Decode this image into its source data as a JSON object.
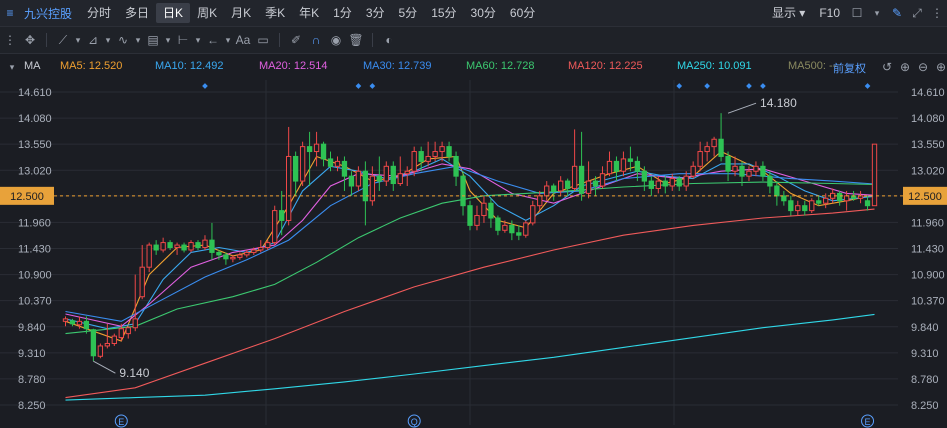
{
  "topbar": {
    "stock_name": "九兴控股",
    "periods": [
      "分时",
      "多日",
      "日K",
      "周K",
      "月K",
      "季K",
      "年K",
      "1分",
      "3分",
      "5分",
      "15分",
      "30分",
      "60分"
    ],
    "active_period": "日K",
    "display_label": "显示",
    "f10_label": "F10"
  },
  "toolbar": {
    "text_tool": "Aa"
  },
  "ma_bar": {
    "indicator": "MA",
    "items": [
      {
        "label": "MA5: 12.520",
        "color": "#f0a030"
      },
      {
        "label": "MA10: 12.492",
        "color": "#3aa8f0"
      },
      {
        "label": "MA20: 12.514",
        "color": "#e060e0"
      },
      {
        "label": "MA30: 12.739",
        "color": "#3a8df0"
      },
      {
        "label": "MA60: 12.728",
        "color": "#3cc870"
      },
      {
        "label": "MA120: 12.225",
        "color": "#f05a5a"
      },
      {
        "label": "MA250: 10.091",
        "color": "#30d8e8"
      },
      {
        "label": "MA500: --",
        "color": "#8a8a60"
      }
    ],
    "adjust_label": "前复权"
  },
  "chart_data": {
    "type": "candlestick",
    "y_ticks": [
      "14.610",
      "14.080",
      "13.550",
      "13.020",
      "12.500",
      "11.960",
      "11.430",
      "10.900",
      "10.370",
      "9.840",
      "9.310",
      "8.780",
      "8.250"
    ],
    "ylim": [
      8.25,
      14.61
    ],
    "current_price": "12.500",
    "annotations": [
      {
        "text": "14.180",
        "value": 14.18,
        "index": 95
      },
      {
        "text": "9.140",
        "value": 9.14,
        "index": 4
      }
    ],
    "event_markers": [
      {
        "text": "E",
        "index": 8
      },
      {
        "text": "Q",
        "index": 50
      },
      {
        "text": "E",
        "index": 115
      }
    ],
    "candles": [
      [
        9.95,
        10.0,
        9.85,
        10.05
      ],
      [
        9.96,
        9.9,
        9.85,
        10.0
      ],
      [
        9.88,
        9.95,
        9.8,
        10.05
      ],
      [
        9.95,
        9.8,
        9.7,
        10.05
      ],
      [
        9.78,
        9.25,
        9.14,
        9.8
      ],
      [
        9.24,
        9.45,
        9.2,
        9.5
      ],
      [
        9.45,
        9.5,
        9.4,
        9.9
      ],
      [
        9.5,
        9.65,
        9.45,
        9.7
      ],
      [
        9.62,
        9.8,
        9.55,
        9.9
      ],
      [
        9.7,
        9.82,
        9.6,
        9.85
      ],
      [
        9.82,
        10.0,
        9.75,
        10.9
      ],
      [
        10.45,
        11.05,
        10.4,
        11.5
      ],
      [
        11.05,
        11.5,
        10.95,
        11.55
      ],
      [
        11.5,
        11.4,
        11.3,
        11.6
      ],
      [
        11.4,
        11.55,
        11.35,
        11.65
      ],
      [
        11.55,
        11.45,
        11.4,
        11.6
      ],
      [
        11.45,
        11.5,
        11.3,
        11.55
      ],
      [
        11.5,
        11.4,
        11.35,
        11.55
      ],
      [
        11.4,
        11.55,
        11.35,
        11.6
      ],
      [
        11.55,
        11.45,
        11.4,
        11.6
      ],
      [
        11.45,
        11.6,
        11.4,
        11.7
      ],
      [
        11.6,
        11.35,
        11.2,
        11.95
      ],
      [
        11.35,
        11.3,
        11.2,
        11.4
      ],
      [
        11.3,
        11.22,
        11.1,
        11.35
      ],
      [
        11.22,
        11.25,
        11.15,
        11.3
      ],
      [
        11.25,
        11.3,
        11.2,
        11.35
      ],
      [
        11.3,
        11.35,
        11.25,
        11.4
      ],
      [
        11.35,
        11.4,
        11.3,
        11.45
      ],
      [
        11.4,
        11.45,
        11.35,
        11.6
      ],
      [
        11.45,
        11.55,
        11.4,
        11.6
      ],
      [
        11.55,
        12.2,
        11.5,
        12.3
      ],
      [
        12.2,
        12.0,
        11.7,
        12.6
      ],
      [
        12.0,
        13.3,
        11.9,
        13.9
      ],
      [
        13.3,
        12.8,
        12.5,
        13.4
      ],
      [
        12.8,
        13.5,
        12.7,
        13.6
      ],
      [
        13.5,
        13.4,
        12.7,
        13.8
      ],
      [
        13.4,
        13.55,
        13.1,
        13.8
      ],
      [
        13.55,
        13.25,
        13.1,
        13.6
      ],
      [
        13.25,
        13.1,
        13.0,
        13.4
      ],
      [
        13.1,
        13.2,
        13.0,
        13.3
      ],
      [
        13.2,
        12.9,
        12.6,
        13.3
      ],
      [
        12.9,
        12.7,
        12.5,
        13.0
      ],
      [
        12.7,
        13.0,
        12.6,
        13.1
      ],
      [
        13.0,
        12.4,
        11.9,
        13.2
      ],
      [
        12.4,
        12.9,
        12.3,
        13.1
      ],
      [
        12.9,
        12.8,
        12.6,
        13.3
      ],
      [
        12.8,
        13.1,
        12.7,
        13.2
      ],
      [
        13.1,
        12.75,
        12.6,
        13.2
      ],
      [
        12.75,
        12.95,
        12.7,
        13.3
      ],
      [
        12.95,
        13.0,
        12.7,
        13.1
      ],
      [
        13.0,
        13.4,
        12.9,
        13.5
      ],
      [
        13.4,
        13.2,
        13.0,
        13.5
      ],
      [
        13.2,
        13.3,
        13.1,
        13.6
      ],
      [
        13.3,
        13.4,
        13.2,
        13.6
      ],
      [
        13.4,
        13.5,
        13.2,
        13.6
      ],
      [
        13.5,
        13.3,
        13.2,
        13.6
      ],
      [
        13.3,
        12.9,
        12.7,
        13.4
      ],
      [
        12.9,
        12.3,
        12.1,
        13.0
      ],
      [
        12.3,
        11.9,
        11.8,
        12.4
      ],
      [
        11.9,
        12.1,
        11.8,
        12.3
      ],
      [
        12.1,
        12.35,
        11.95,
        12.5
      ],
      [
        12.35,
        12.05,
        11.85,
        12.45
      ],
      [
        12.05,
        11.8,
        11.7,
        12.1
      ],
      [
        11.8,
        11.9,
        11.75,
        12.0
      ],
      [
        11.9,
        11.75,
        11.6,
        12.0
      ],
      [
        11.75,
        11.7,
        11.6,
        11.9
      ],
      [
        11.7,
        11.95,
        11.65,
        12.0
      ],
      [
        11.95,
        12.3,
        11.9,
        12.4
      ],
      [
        12.3,
        12.5,
        12.2,
        12.6
      ],
      [
        12.5,
        12.7,
        12.4,
        12.8
      ],
      [
        12.7,
        12.6,
        12.4,
        12.75
      ],
      [
        12.6,
        12.8,
        12.5,
        12.9
      ],
      [
        12.8,
        12.65,
        12.5,
        12.85
      ],
      [
        12.65,
        13.1,
        12.6,
        13.85
      ],
      [
        13.1,
        12.55,
        12.4,
        13.8
      ],
      [
        12.55,
        12.8,
        12.45,
        13.2
      ],
      [
        12.8,
        12.7,
        12.5,
        12.9
      ],
      [
        12.7,
        12.95,
        12.65,
        13.1
      ],
      [
        12.95,
        13.2,
        12.9,
        13.4
      ],
      [
        13.2,
        13.0,
        12.8,
        13.3
      ],
      [
        13.0,
        13.25,
        12.9,
        13.4
      ],
      [
        13.25,
        13.2,
        13.0,
        13.5
      ],
      [
        13.2,
        13.0,
        12.8,
        13.3
      ],
      [
        13.0,
        12.8,
        12.6,
        13.1
      ],
      [
        12.8,
        12.65,
        12.5,
        12.9
      ],
      [
        12.65,
        12.8,
        12.55,
        12.9
      ],
      [
        12.8,
        12.7,
        12.55,
        12.9
      ],
      [
        12.7,
        12.85,
        12.6,
        12.95
      ],
      [
        12.85,
        12.7,
        12.6,
        12.9
      ],
      [
        12.7,
        12.9,
        12.6,
        13.0
      ],
      [
        12.9,
        13.1,
        12.85,
        13.2
      ],
      [
        13.1,
        13.4,
        13.0,
        13.6
      ],
      [
        13.4,
        13.5,
        13.2,
        13.6
      ],
      [
        13.5,
        13.65,
        13.3,
        13.7
      ],
      [
        13.65,
        13.3,
        13.2,
        14.18
      ],
      [
        13.3,
        13.0,
        12.8,
        13.4
      ],
      [
        13.0,
        13.1,
        12.9,
        13.3
      ],
      [
        13.1,
        12.9,
        12.7,
        13.2
      ],
      [
        12.9,
        13.0,
        12.8,
        13.1
      ],
      [
        13.0,
        13.1,
        12.9,
        13.2
      ],
      [
        13.1,
        12.9,
        12.8,
        13.2
      ],
      [
        12.9,
        12.7,
        12.55,
        13.0
      ],
      [
        12.7,
        12.5,
        12.3,
        12.8
      ],
      [
        12.5,
        12.4,
        12.3,
        12.6
      ],
      [
        12.4,
        12.2,
        12.1,
        12.5
      ],
      [
        12.2,
        12.3,
        12.1,
        12.4
      ],
      [
        12.3,
        12.2,
        12.1,
        12.4
      ],
      [
        12.2,
        12.4,
        12.15,
        12.45
      ],
      [
        12.4,
        12.35,
        12.3,
        12.5
      ],
      [
        12.35,
        12.45,
        12.25,
        12.55
      ],
      [
        12.45,
        12.55,
        12.35,
        12.65
      ],
      [
        12.55,
        12.4,
        12.3,
        12.6
      ],
      [
        12.4,
        12.5,
        12.2,
        12.6
      ],
      [
        12.5,
        12.45,
        12.4,
        12.6
      ],
      [
        12.45,
        12.5,
        12.35,
        12.6
      ],
      [
        12.4,
        12.3,
        12.2,
        12.5
      ],
      [
        12.3,
        13.55,
        12.4,
        13.55
      ]
    ],
    "ma_lines": {
      "MA5": [
        [
          0,
          9.95
        ],
        [
          4,
          9.75
        ],
        [
          8,
          9.55
        ],
        [
          12,
          10.9
        ],
        [
          16,
          11.45
        ],
        [
          20,
          11.5
        ],
        [
          24,
          11.28
        ],
        [
          28,
          11.4
        ],
        [
          32,
          12.3
        ],
        [
          36,
          13.3
        ],
        [
          40,
          13.1
        ],
        [
          44,
          12.8
        ],
        [
          48,
          12.9
        ],
        [
          52,
          13.25
        ],
        [
          56,
          13.3
        ],
        [
          58,
          12.6
        ],
        [
          62,
          12.0
        ],
        [
          66,
          11.85
        ],
        [
          70,
          12.55
        ],
        [
          74,
          12.75
        ],
        [
          78,
          12.95
        ],
        [
          82,
          13.1
        ],
        [
          86,
          12.75
        ],
        [
          90,
          12.9
        ],
        [
          94,
          13.4
        ],
        [
          97,
          13.2
        ],
        [
          100,
          13.0
        ],
        [
          104,
          12.55
        ],
        [
          108,
          12.3
        ],
        [
          112,
          12.4
        ],
        [
          116,
          12.52
        ]
      ],
      "MA10": [
        [
          0,
          10.0
        ],
        [
          6,
          9.8
        ],
        [
          10,
          9.9
        ],
        [
          14,
          10.8
        ],
        [
          18,
          11.35
        ],
        [
          22,
          11.45
        ],
        [
          26,
          11.35
        ],
        [
          30,
          11.55
        ],
        [
          34,
          12.6
        ],
        [
          38,
          13.1
        ],
        [
          42,
          13.0
        ],
        [
          46,
          12.85
        ],
        [
          50,
          13.0
        ],
        [
          54,
          13.25
        ],
        [
          58,
          12.9
        ],
        [
          62,
          12.3
        ],
        [
          66,
          12.0
        ],
        [
          70,
          12.3
        ],
        [
          74,
          12.7
        ],
        [
          78,
          12.85
        ],
        [
          82,
          13.0
        ],
        [
          86,
          12.9
        ],
        [
          90,
          12.85
        ],
        [
          94,
          13.15
        ],
        [
          98,
          13.15
        ],
        [
          102,
          12.9
        ],
        [
          106,
          12.6
        ],
        [
          110,
          12.4
        ],
        [
          116,
          12.49
        ]
      ],
      "MA20": [
        [
          0,
          10.1
        ],
        [
          8,
          9.85
        ],
        [
          12,
          10.3
        ],
        [
          18,
          11.05
        ],
        [
          24,
          11.35
        ],
        [
          30,
          11.5
        ],
        [
          34,
          12.0
        ],
        [
          38,
          12.7
        ],
        [
          42,
          12.95
        ],
        [
          48,
          12.9
        ],
        [
          54,
          13.15
        ],
        [
          58,
          13.05
        ],
        [
          64,
          12.55
        ],
        [
          70,
          12.35
        ],
        [
          76,
          12.65
        ],
        [
          82,
          12.95
        ],
        [
          88,
          12.85
        ],
        [
          94,
          13.0
        ],
        [
          100,
          13.05
        ],
        [
          106,
          12.8
        ],
        [
          112,
          12.55
        ],
        [
          116,
          12.51
        ]
      ],
      "MA30": [
        [
          0,
          10.15
        ],
        [
          8,
          9.95
        ],
        [
          14,
          10.4
        ],
        [
          20,
          10.85
        ],
        [
          26,
          11.2
        ],
        [
          32,
          11.6
        ],
        [
          38,
          12.3
        ],
        [
          44,
          12.75
        ],
        [
          50,
          12.95
        ],
        [
          56,
          13.1
        ],
        [
          62,
          12.8
        ],
        [
          68,
          12.55
        ],
        [
          74,
          12.6
        ],
        [
          80,
          12.85
        ],
        [
          88,
          12.95
        ],
        [
          96,
          12.95
        ],
        [
          104,
          12.85
        ],
        [
          110,
          12.8
        ],
        [
          116,
          12.74
        ]
      ],
      "MA60": [
        [
          0,
          9.7
        ],
        [
          10,
          9.85
        ],
        [
          16,
          10.2
        ],
        [
          24,
          10.45
        ],
        [
          30,
          10.7
        ],
        [
          36,
          11.15
        ],
        [
          42,
          11.65
        ],
        [
          48,
          12.05
        ],
        [
          54,
          12.35
        ],
        [
          60,
          12.5
        ],
        [
          66,
          12.55
        ],
        [
          72,
          12.6
        ],
        [
          80,
          12.68
        ],
        [
          90,
          12.75
        ],
        [
          100,
          12.78
        ],
        [
          110,
          12.75
        ],
        [
          116,
          12.73
        ]
      ],
      "MA120": [
        [
          0,
          8.4
        ],
        [
          10,
          8.6
        ],
        [
          20,
          9.1
        ],
        [
          30,
          9.6
        ],
        [
          40,
          10.15
        ],
        [
          50,
          10.65
        ],
        [
          60,
          11.05
        ],
        [
          70,
          11.4
        ],
        [
          80,
          11.7
        ],
        [
          90,
          11.9
        ],
        [
          100,
          12.05
        ],
        [
          110,
          12.15
        ],
        [
          116,
          12.23
        ]
      ],
      "MA250": [
        [
          0,
          8.35
        ],
        [
          10,
          8.4
        ],
        [
          20,
          8.45
        ],
        [
          30,
          8.58
        ],
        [
          40,
          8.72
        ],
        [
          50,
          8.88
        ],
        [
          60,
          9.05
        ],
        [
          70,
          9.22
        ],
        [
          80,
          9.42
        ],
        [
          90,
          9.62
        ],
        [
          100,
          9.82
        ],
        [
          110,
          9.98
        ],
        [
          116,
          10.09
        ]
      ]
    }
  }
}
